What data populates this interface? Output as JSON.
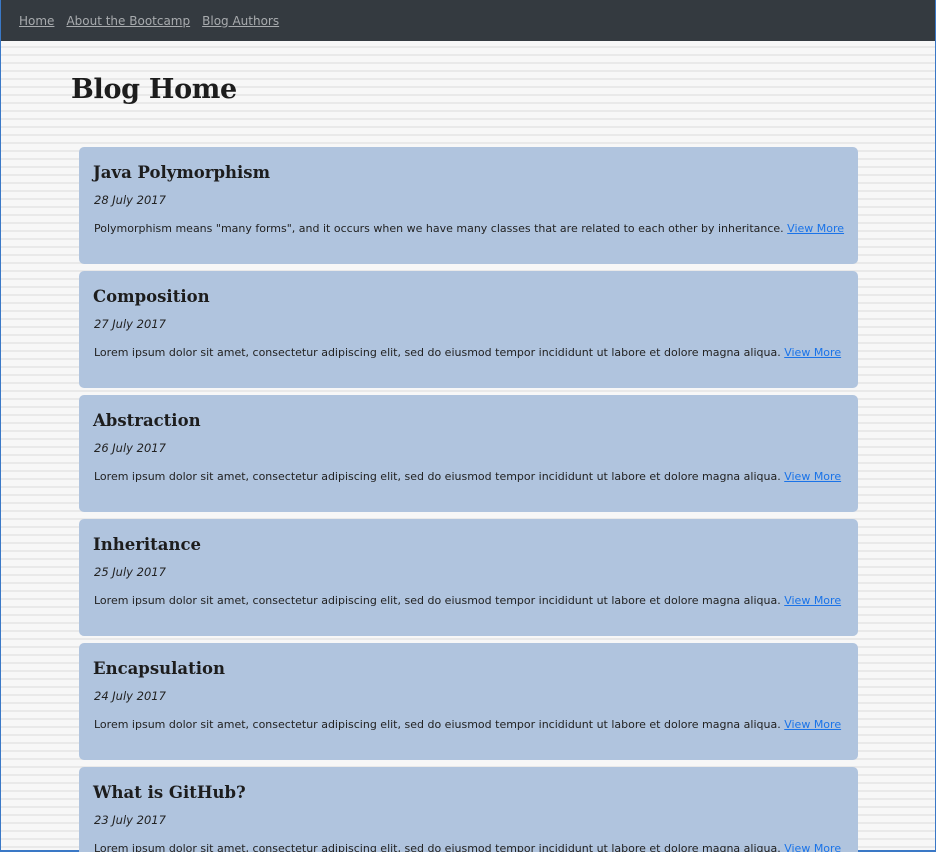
{
  "nav": {
    "links": [
      "Home",
      "About the Bootcamp",
      "Blog Authors"
    ]
  },
  "page": {
    "title": "Blog Home"
  },
  "posts": [
    {
      "title": "Java Polymorphism",
      "date": "28 July 2017",
      "excerpt": "Polymorphism means \"many forms\", and it occurs when we have many classes that are related to each other by inheritance.",
      "link": "View More"
    },
    {
      "title": "Composition",
      "date": "27 July 2017",
      "excerpt": "Lorem ipsum dolor sit amet, consectetur adipiscing elit, sed do eiusmod tempor incididunt ut labore et dolore magna aliqua.",
      "link": "View More"
    },
    {
      "title": "Abstraction",
      "date": "26 July 2017",
      "excerpt": "Lorem ipsum dolor sit amet, consectetur adipiscing elit, sed do eiusmod tempor incididunt ut labore et dolore magna aliqua.",
      "link": "View More"
    },
    {
      "title": "Inheritance",
      "date": "25 July 2017",
      "excerpt": "Lorem ipsum dolor sit amet, consectetur adipiscing elit, sed do eiusmod tempor incididunt ut labore et dolore magna aliqua.",
      "link": "View More"
    },
    {
      "title": "Encapsulation",
      "date": "24 July 2017",
      "excerpt": "Lorem ipsum dolor sit amet, consectetur adipiscing elit, sed do eiusmod tempor incididunt ut labore et dolore magna aliqua.",
      "link": "View More"
    },
    {
      "title": "What is GitHub?",
      "date": "23 July 2017",
      "excerpt": "Lorem ipsum dolor sit amet, consectetur adipiscing elit, sed do eiusmod tempor incididunt ut labore et dolore magna aliqua.",
      "link": "View More"
    }
  ],
  "colors": {
    "navbar": "#343a40",
    "card": "#b0c4de",
    "link": "#1a73e8"
  }
}
